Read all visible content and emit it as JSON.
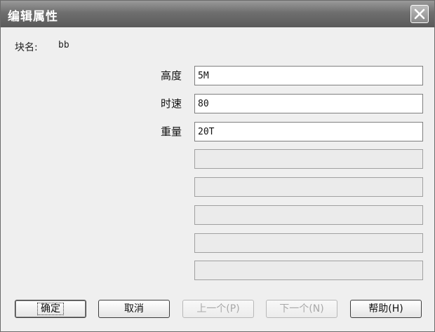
{
  "window": {
    "title": "编辑属性"
  },
  "block": {
    "label": "块名:",
    "value": "bb"
  },
  "attributes": [
    {
      "label": "高度",
      "value": "5M"
    },
    {
      "label": "时速",
      "value": "80"
    },
    {
      "label": "重量",
      "value": "20T"
    },
    {
      "label": "",
      "value": ""
    },
    {
      "label": "",
      "value": ""
    },
    {
      "label": "",
      "value": ""
    },
    {
      "label": "",
      "value": ""
    },
    {
      "label": "",
      "value": ""
    }
  ],
  "buttons": {
    "ok": "确定",
    "cancel": "取消",
    "prev": "上一个(P)",
    "next": "下一个(N)",
    "help": "帮助(H)"
  }
}
